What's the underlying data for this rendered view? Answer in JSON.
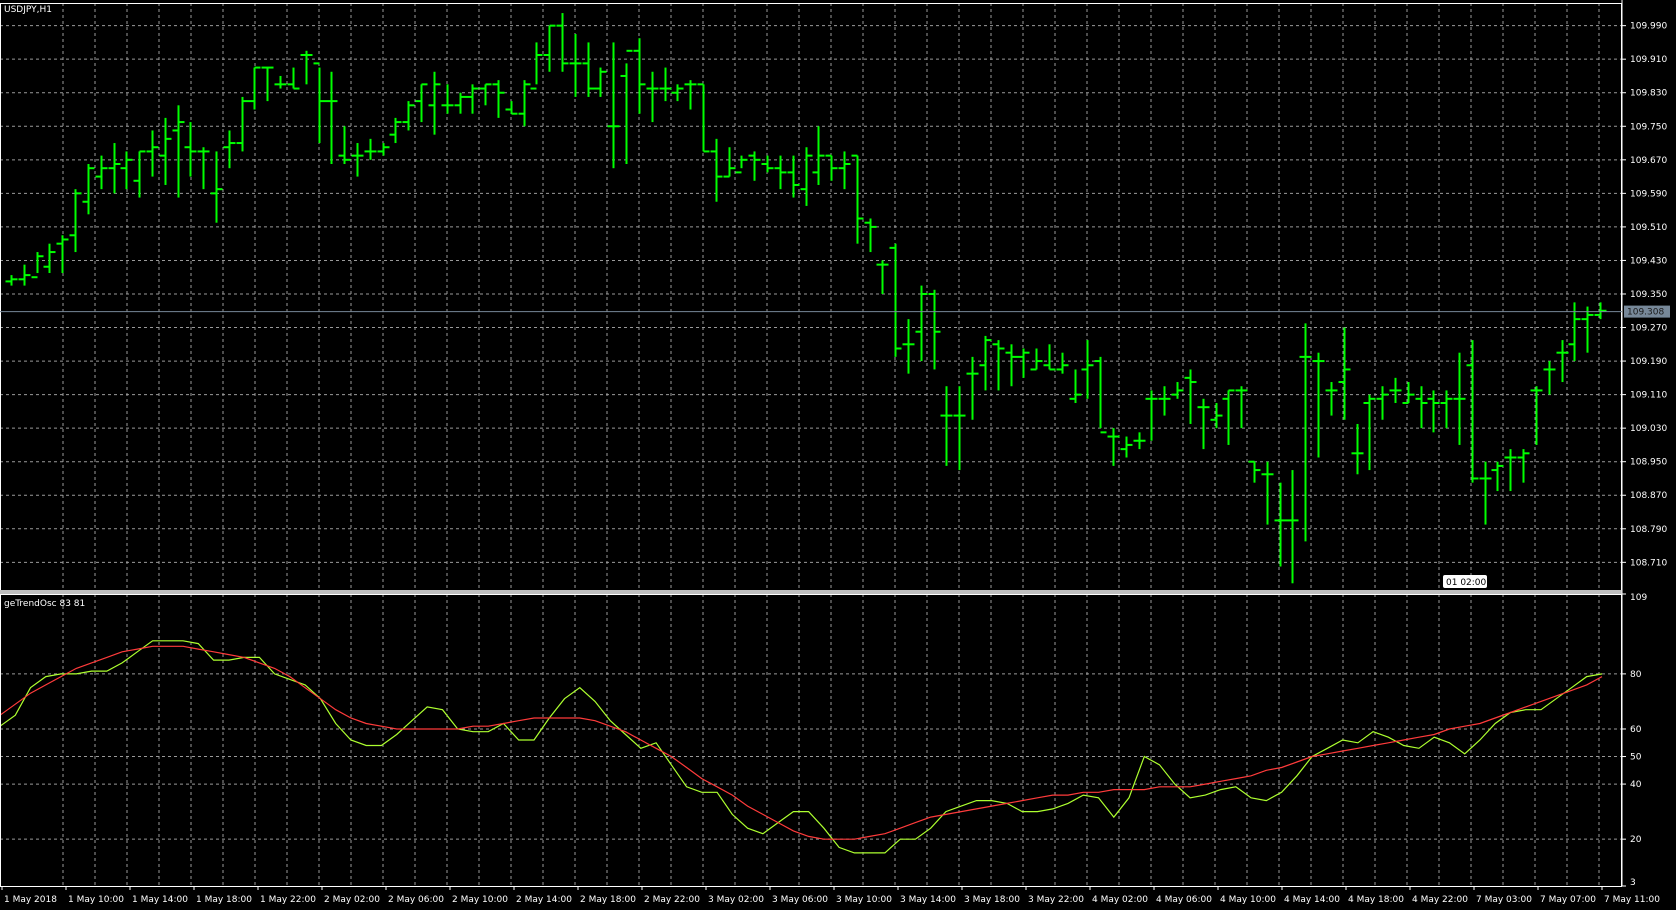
{
  "window": {
    "symbol_label": "USDJPY,H1",
    "indicator_label": "geTrendOsc 83 81"
  },
  "colors": {
    "background": "#000000",
    "grid": "#9a9a9a",
    "frame": "#ffffff",
    "bars": "#00ff00",
    "price_line": "#778899",
    "osc_fast": "#adff2f",
    "osc_slow": "#ff3b3b"
  },
  "chart_data": [
    {
      "type": "ohlc",
      "symbol": "USDJPY",
      "timeframe": "H1",
      "y_ticks": [
        "109.990",
        "109.910",
        "109.830",
        "109.750",
        "109.670",
        "109.590",
        "109.510",
        "109.430",
        "109.350",
        "109.270",
        "109.190",
        "109.110",
        "109.030",
        "108.950",
        "108.870",
        "108.790",
        "108.710"
      ],
      "ylim": [
        108.644,
        110.044
      ],
      "current_price": "109.308",
      "crosshair_time_label": "01 02:00",
      "x_labels": [
        "1 May 2018",
        "1 May 10:00",
        "1 May 14:00",
        "1 May 18:00",
        "1 May 22:00",
        "2 May 02:00",
        "2 May 06:00",
        "2 May 10:00",
        "2 May 14:00",
        "2 May 18:00",
        "2 May 22:00",
        "3 May 02:00",
        "3 May 06:00",
        "3 May 10:00",
        "3 May 14:00",
        "3 May 18:00",
        "3 May 22:00",
        "4 May 02:00",
        "4 May 06:00",
        "4 May 10:00",
        "4 May 14:00",
        "4 May 18:00",
        "4 May 22:00",
        "7 May 03:00",
        "7 May 07:00",
        "7 May 11:00"
      ],
      "ohlc": [
        [
          109.38,
          109.395,
          109.37,
          109.385
        ],
        [
          109.385,
          109.42,
          109.37,
          109.395
        ],
        [
          109.39,
          109.45,
          109.4,
          109.44
        ],
        [
          109.415,
          109.47,
          109.4,
          109.45
        ],
        [
          109.47,
          109.49,
          109.4,
          109.48
        ],
        [
          109.49,
          109.6,
          109.45,
          109.59
        ],
        [
          109.57,
          109.66,
          109.54,
          109.65
        ],
        [
          109.63,
          109.68,
          109.6,
          109.65
        ],
        [
          109.65,
          109.71,
          109.59,
          109.66
        ],
        [
          109.65,
          109.69,
          109.6,
          109.67
        ],
        [
          109.62,
          109.69,
          109.58,
          109.69
        ],
        [
          109.69,
          109.74,
          109.63,
          109.7
        ],
        [
          109.68,
          109.77,
          109.61,
          109.72
        ],
        [
          109.74,
          109.8,
          109.58,
          109.76
        ],
        [
          109.7,
          109.76,
          109.63,
          109.69
        ],
        [
          109.69,
          109.7,
          109.6,
          109.69
        ],
        [
          109.59,
          109.69,
          109.52,
          109.6
        ],
        [
          109.7,
          109.74,
          109.65,
          109.71
        ],
        [
          109.71,
          109.82,
          109.69,
          109.81
        ],
        [
          109.81,
          109.89,
          109.79,
          109.89
        ],
        [
          109.89,
          109.89,
          109.81,
          109.89
        ],
        [
          109.85,
          109.87,
          109.84,
          109.85
        ],
        [
          109.85,
          109.89,
          109.84,
          109.84
        ],
        [
          109.92,
          109.93,
          109.85,
          109.92
        ],
        [
          109.9,
          109.89,
          109.71,
          109.81
        ],
        [
          109.81,
          109.88,
          109.66,
          109.81
        ],
        [
          109.68,
          109.75,
          109.66,
          109.67
        ],
        [
          109.68,
          109.71,
          109.63,
          109.68
        ],
        [
          109.69,
          109.72,
          109.67,
          109.69
        ],
        [
          109.69,
          109.71,
          109.68,
          109.7
        ],
        [
          109.73,
          109.77,
          109.71,
          109.76
        ],
        [
          109.76,
          109.81,
          109.74,
          109.8
        ],
        [
          109.81,
          109.85,
          109.76,
          109.85
        ],
        [
          109.8,
          109.88,
          109.73,
          109.85
        ],
        [
          109.8,
          109.85,
          109.78,
          109.8
        ],
        [
          109.8,
          109.83,
          109.78,
          109.82
        ],
        [
          109.82,
          109.85,
          109.78,
          109.84
        ],
        [
          109.84,
          109.85,
          109.8,
          109.85
        ],
        [
          109.85,
          109.86,
          109.77,
          109.83
        ],
        [
          109.79,
          109.81,
          109.78,
          109.78
        ],
        [
          109.78,
          109.86,
          109.75,
          109.85
        ],
        [
          109.84,
          109.95,
          109.85,
          109.92
        ],
        [
          109.92,
          109.99,
          109.88,
          109.99
        ],
        [
          109.99,
          110.02,
          109.88,
          109.9
        ],
        [
          109.9,
          109.97,
          109.82,
          109.9
        ],
        [
          109.9,
          109.95,
          109.82,
          109.84
        ],
        [
          109.84,
          109.89,
          109.82,
          109.88
        ],
        [
          109.75,
          109.95,
          109.65,
          109.75
        ],
        [
          109.87,
          109.9,
          109.66,
          109.93
        ],
        [
          109.93,
          109.96,
          109.78,
          109.85
        ],
        [
          109.84,
          109.88,
          109.76,
          109.84
        ],
        [
          109.84,
          109.89,
          109.81,
          109.84
        ],
        [
          109.83,
          109.85,
          109.81,
          109.84
        ],
        [
          109.85,
          109.86,
          109.79,
          109.85
        ],
        [
          109.85,
          109.85,
          109.69,
          109.69
        ],
        [
          109.69,
          109.72,
          109.57,
          109.63
        ],
        [
          109.63,
          109.7,
          109.63,
          109.65
        ],
        [
          109.64,
          109.68,
          109.65,
          109.67
        ],
        [
          109.68,
          109.69,
          109.62,
          109.67
        ],
        [
          109.66,
          109.68,
          109.64,
          109.65
        ],
        [
          109.65,
          109.68,
          109.6,
          109.64
        ],
        [
          109.64,
          109.68,
          109.58,
          109.61
        ],
        [
          109.6,
          109.7,
          109.56,
          109.68
        ],
        [
          109.64,
          109.75,
          109.61,
          109.68
        ],
        [
          109.68,
          109.68,
          109.62,
          109.65
        ],
        [
          109.65,
          109.69,
          109.6,
          109.66
        ],
        [
          109.68,
          109.68,
          109.47,
          109.53
        ],
        [
          109.52,
          109.53,
          109.45,
          109.51
        ],
        [
          109.42,
          109.43,
          109.35,
          109.42
        ],
        [
          109.46,
          109.47,
          109.2,
          109.22
        ],
        [
          109.23,
          109.29,
          109.16,
          109.23
        ],
        [
          109.26,
          109.37,
          109.19,
          109.35
        ],
        [
          109.35,
          109.36,
          109.17,
          109.26
        ],
        [
          109.06,
          109.13,
          108.94,
          109.06
        ],
        [
          109.06,
          109.13,
          108.93,
          109.06
        ],
        [
          109.16,
          109.2,
          109.05,
          109.16
        ],
        [
          109.18,
          109.25,
          109.12,
          109.24
        ],
        [
          109.23,
          109.24,
          109.12,
          109.22
        ],
        [
          109.21,
          109.23,
          109.13,
          109.2
        ],
        [
          109.2,
          109.22,
          109.15,
          109.21
        ],
        [
          109.17,
          109.22,
          109.17,
          109.19
        ],
        [
          109.18,
          109.23,
          109.17,
          109.17
        ],
        [
          109.17,
          109.21,
          109.16,
          109.18
        ],
        [
          109.1,
          109.17,
          109.09,
          109.11
        ],
        [
          109.17,
          109.24,
          109.1,
          109.18
        ],
        [
          109.19,
          109.2,
          109.03,
          109.02
        ],
        [
          109.01,
          109.03,
          108.94,
          109.01
        ],
        [
          108.98,
          109.01,
          108.96,
          108.99
        ],
        [
          109.0,
          109.02,
          108.98,
          109.0
        ],
        [
          109.1,
          109.12,
          109.0,
          109.1
        ],
        [
          109.1,
          109.13,
          109.06,
          109.1
        ],
        [
          109.11,
          109.14,
          109.1,
          109.12
        ],
        [
          109.15,
          109.17,
          109.04,
          109.14
        ],
        [
          109.08,
          109.1,
          108.98,
          109.08
        ],
        [
          109.05,
          109.09,
          109.03,
          109.06
        ],
        [
          109.1,
          109.12,
          108.99,
          109.12
        ],
        [
          109.12,
          109.13,
          109.03,
          109.12
        ],
        [
          108.95,
          108.95,
          108.9,
          108.93
        ],
        [
          108.92,
          108.95,
          108.8,
          108.92
        ],
        [
          108.81,
          108.9,
          108.7,
          108.81
        ],
        [
          108.81,
          108.93,
          108.66,
          108.81
        ],
        [
          109.2,
          109.28,
          108.76,
          109.2
        ],
        [
          109.19,
          109.21,
          108.96,
          109.19
        ],
        [
          109.12,
          109.14,
          109.06,
          109.12
        ],
        [
          109.14,
          109.27,
          109.05,
          109.17
        ],
        [
          108.97,
          109.04,
          108.92,
          108.97
        ],
        [
          109.09,
          109.11,
          108.93,
          109.1
        ],
        [
          109.1,
          109.13,
          109.05,
          109.11
        ],
        [
          109.12,
          109.15,
          109.09,
          109.12
        ],
        [
          109.09,
          109.14,
          109.09,
          109.11
        ],
        [
          109.1,
          109.13,
          109.03,
          109.09
        ],
        [
          109.1,
          109.12,
          109.02,
          109.09
        ],
        [
          109.09,
          109.12,
          109.03,
          109.1
        ],
        [
          109.1,
          109.21,
          108.99,
          109.1
        ],
        [
          109.18,
          109.24,
          108.9,
          108.91
        ],
        [
          108.91,
          108.95,
          108.8,
          108.91
        ],
        [
          108.93,
          108.95,
          108.88,
          108.94
        ],
        [
          108.96,
          108.98,
          108.88,
          108.96
        ],
        [
          108.96,
          108.98,
          108.9,
          108.97
        ],
        [
          109.12,
          109.13,
          108.99,
          109.12
        ],
        [
          109.17,
          109.19,
          109.11,
          109.17
        ],
        [
          109.21,
          109.24,
          109.14,
          109.21
        ],
        [
          109.23,
          109.33,
          109.19,
          109.29
        ],
        [
          109.29,
          109.32,
          109.21,
          109.3
        ],
        [
          109.3,
          109.33,
          109.29,
          109.31
        ]
      ]
    },
    {
      "type": "line",
      "name": "geTrendOsc 83 81",
      "y_ticks": [
        "109",
        "80",
        "60",
        "50",
        "40",
        "20",
        "3"
      ],
      "ylim": [
        3,
        109
      ],
      "series": [
        {
          "id": "fast",
          "values": [
            61,
            65,
            75,
            79,
            80,
            80,
            81,
            81,
            84,
            88,
            92,
            92,
            92,
            91,
            85,
            85,
            86,
            86,
            80,
            78,
            76,
            71,
            62,
            56,
            54,
            54,
            58,
            63,
            68,
            67,
            60,
            59,
            59,
            62,
            56,
            56,
            64,
            71,
            75,
            70,
            63,
            58,
            53,
            55,
            47,
            39,
            37,
            37,
            29,
            24,
            22,
            26,
            30,
            30,
            24,
            17,
            15,
            15,
            15,
            20,
            20,
            24,
            30,
            32,
            34,
            34,
            33,
            30,
            30,
            31,
            33,
            36,
            35,
            28,
            35,
            50,
            47,
            40,
            35,
            36,
            38,
            39,
            35,
            34,
            37,
            43,
            50,
            53,
            56,
            55,
            59,
            57,
            54,
            53,
            57,
            55,
            51,
            56,
            62,
            66,
            67,
            67,
            71,
            75,
            79,
            80
          ]
        },
        {
          "id": "slow",
          "values": [
            65,
            69,
            73,
            76,
            79,
            82,
            84,
            86,
            88,
            89,
            90,
            90,
            90,
            89,
            88,
            87,
            86,
            84,
            82,
            79,
            75,
            71,
            67,
            64,
            62,
            61,
            60,
            60,
            60,
            60,
            60,
            61,
            61,
            62,
            63,
            64,
            64,
            64,
            64,
            63,
            61,
            59,
            56,
            53,
            50,
            46,
            42,
            39,
            36,
            32,
            29,
            26,
            23,
            21,
            20,
            20,
            20,
            21,
            22,
            24,
            26,
            28,
            29,
            30,
            31,
            32,
            33,
            34,
            35,
            36,
            36,
            37,
            37,
            38,
            38,
            38,
            39,
            39,
            39,
            40,
            41,
            42,
            43,
            45,
            46,
            48,
            50,
            51,
            52,
            53,
            54,
            55,
            56,
            57,
            58,
            60,
            61,
            62,
            64,
            66,
            68,
            70,
            72,
            74,
            76,
            79
          ]
        }
      ]
    }
  ]
}
